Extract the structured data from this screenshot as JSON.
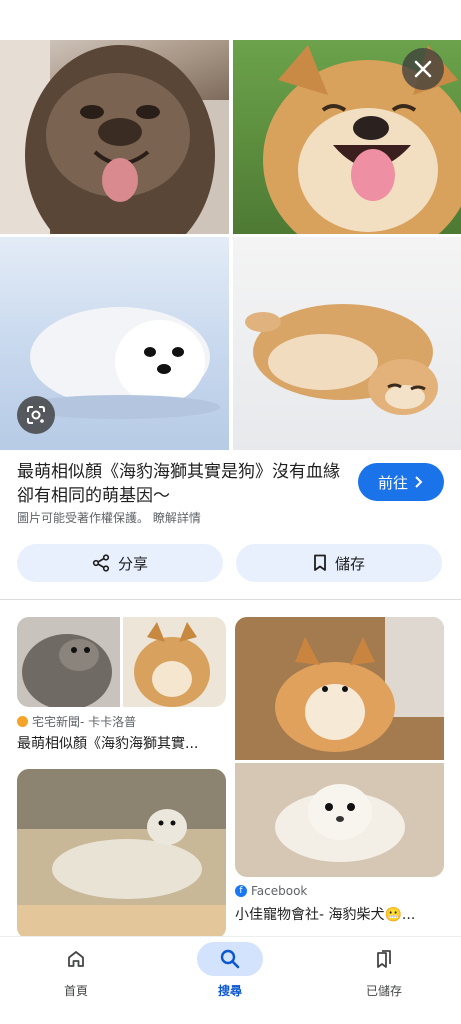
{
  "hero": {
    "close_label": "close",
    "lens_label": "lens"
  },
  "result_main": {
    "title": "最萌相似顏《海豹海獅其實是狗》沒有血緣卻有相同的萌基因〜",
    "go_label": "前往",
    "notice": "圖片可能受著作權保護。 瞭解詳情",
    "share_label": "分享",
    "save_label": "儲存"
  },
  "results": [
    {
      "source": "宅宅新聞- 卡卡洛普",
      "title": "最萌相似顏《海豹海獅其實..."
    },
    {
      "source": "Facebook",
      "title": "小佳寵物會社- 海豹柴犬😬..."
    }
  ],
  "bottom_nav": {
    "items": [
      {
        "label": "首頁",
        "icon": "home-icon"
      },
      {
        "label": "搜尋",
        "icon": "search-icon"
      },
      {
        "label": "已儲存",
        "icon": "saved-icon"
      }
    ]
  },
  "colors": {
    "accent": "#1a73e8",
    "pill_bg": "#e8f0fe",
    "nav_active_bg": "#d3e3fd",
    "nav_active_text": "#0b57d0"
  }
}
